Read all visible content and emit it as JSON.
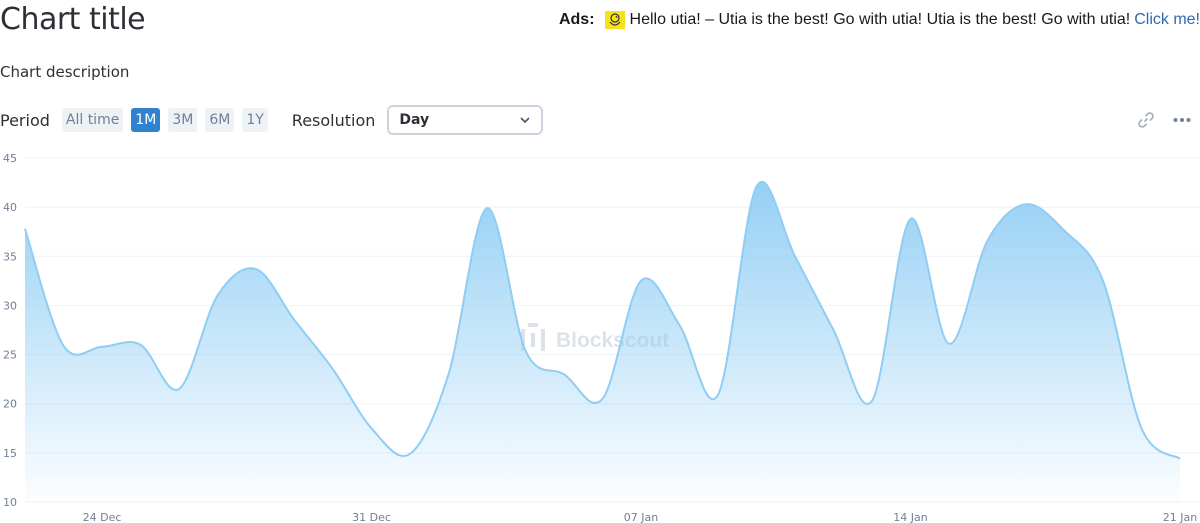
{
  "header": {
    "title": "Chart title",
    "description": "Chart description"
  },
  "ads": {
    "label": "Ads:",
    "icon": "duck-icon",
    "text": "Hello utia! – Utia is the best! Go with utia! Utia is the best! Go with utia!",
    "link": "Click me!"
  },
  "controls": {
    "period_label": "Period",
    "periods": [
      "All time",
      "1M",
      "3M",
      "6M",
      "1Y"
    ],
    "active_period": "1M",
    "resolution_label": "Resolution",
    "resolution_value": "Day"
  },
  "toolbar": {
    "link_icon": "link-icon",
    "menu_icon": "more-options-icon"
  },
  "watermark": "Blockscout",
  "colors": {
    "line": "#90cdf4",
    "fill_top": "#90cdf4",
    "accent": "#3182ce"
  },
  "chart_data": {
    "type": "area",
    "title": "",
    "xlabel": "",
    "ylabel": "",
    "x": [
      "2023-12-22",
      "2023-12-23",
      "2023-12-24",
      "2023-12-25",
      "2023-12-26",
      "2023-12-27",
      "2023-12-28",
      "2023-12-29",
      "2023-12-30",
      "2023-12-31",
      "2024-01-01",
      "2024-01-02",
      "2024-01-03",
      "2024-01-04",
      "2024-01-05",
      "2024-01-06",
      "2024-01-07",
      "2024-01-08",
      "2024-01-09",
      "2024-01-10",
      "2024-01-11",
      "2024-01-12",
      "2024-01-13",
      "2024-01-14",
      "2024-01-15",
      "2024-01-16",
      "2024-01-17",
      "2024-01-18",
      "2024-01-19",
      "2024-01-20",
      "2024-01-21"
    ],
    "values": [
      37.8,
      25.9,
      25.8,
      26.0,
      21.5,
      31.0,
      33.7,
      28.5,
      23.5,
      17.5,
      14.9,
      23.0,
      39.9,
      25.4,
      23.0,
      20.5,
      32.5,
      28.0,
      20.9,
      42.1,
      35.0,
      27.5,
      20.3,
      38.8,
      26.1,
      36.6,
      40.3,
      37.6,
      32.5,
      17.5,
      14.4
    ],
    "xticks": [
      "24 Dec",
      "31 Dec",
      "07 Jan",
      "14 Jan",
      "21 Jan"
    ],
    "ylim": [
      10,
      45
    ],
    "yticks": [
      10,
      15,
      20,
      25,
      30,
      35,
      40,
      45
    ],
    "grid": true,
    "legend": "none"
  }
}
